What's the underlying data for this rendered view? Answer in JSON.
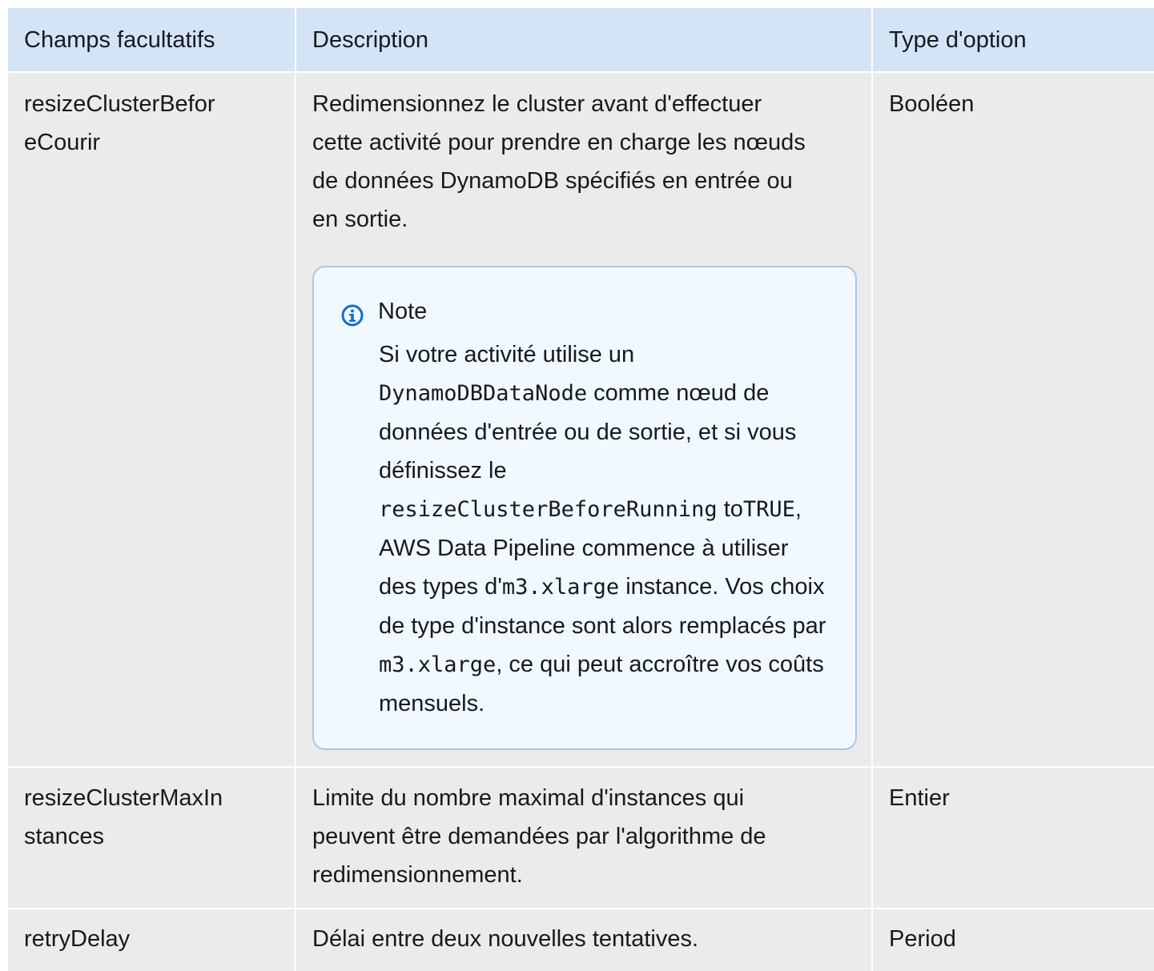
{
  "table": {
    "headers": {
      "field": "Champs facultatifs",
      "description": "Description",
      "type": "Type d'option"
    },
    "rows": [
      {
        "field": "resizeClusterBeforeCourir",
        "field_lines": [
          "resizeClusterBefor",
          "eCourir"
        ],
        "description": "Redimensionnez le cluster avant d'effectuer cette activité pour prendre en charge les nœuds de données DynamoDB spécifiés en entrée ou en sortie.",
        "type": "Booléen",
        "note": {
          "title": "Note",
          "icon": "info-icon",
          "parts": {
            "p1": "Si votre activité utilise un ",
            "code1": "DynamoDBDataNode",
            "p2": " comme nœud de données d'entrée ou de sortie, et si vous définissez le ",
            "code2": "resizeClusterBeforeRunning",
            "p3": " to",
            "code3": "TRUE",
            "p4": ", AWS Data Pipeline commence à utiliser des types d'",
            "code4": "m3.xlarge",
            "p5": " instance. Vos choix de type d'instance sont alors remplacés par ",
            "code5": "m3.xlarge",
            "p6": ", ce qui peut accroître vos coûts mensuels."
          }
        }
      },
      {
        "field": "resizeClusterMaxInstances",
        "field_lines": [
          "resizeClusterMaxIn",
          "stances"
        ],
        "description": "Limite du nombre maximal d'instances qui peuvent être demandées par l'algorithme de redimensionnement.",
        "type": "Entier"
      },
      {
        "field": "retryDelay",
        "description": "Délai entre deux nouvelles tentatives.",
        "type": "Period"
      }
    ]
  },
  "colors": {
    "header_bg": "#d4e4f6",
    "row_bg": "#ebebeb",
    "note_bg": "#f1f8ff",
    "note_border": "#a8c8e8",
    "info_icon": "#0972d3"
  }
}
